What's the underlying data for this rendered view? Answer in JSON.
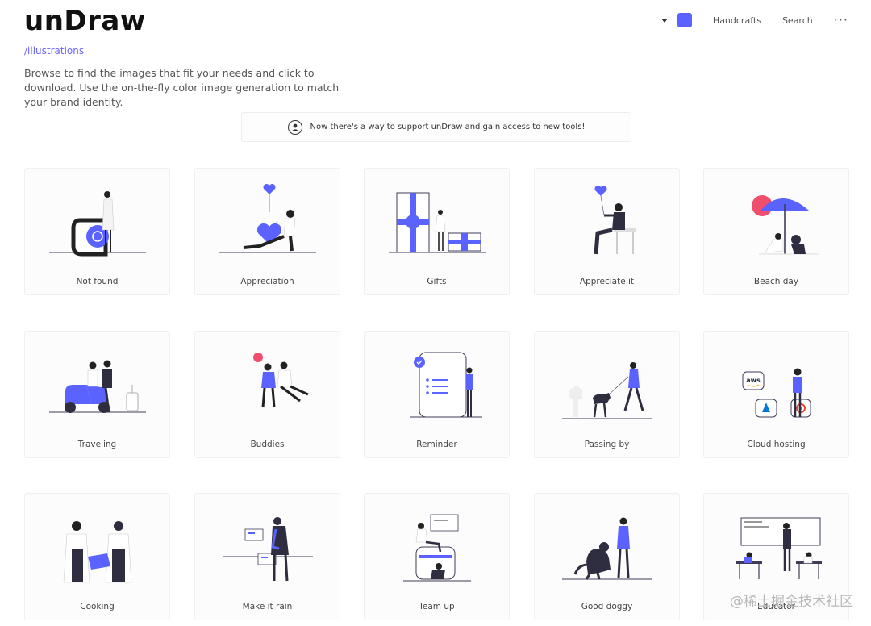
{
  "app": {
    "logo": "unDraw",
    "breadcrumb": "/illustrations"
  },
  "intro": "Browse to find the images that fit your needs and click to download. Use the on-the-fly color image generation to match your brand identity.",
  "nav": {
    "accent_color": "#5a63ff",
    "links": [
      "Handcrafts",
      "Search"
    ],
    "more_icon": "ellipsis-icon"
  },
  "banner": {
    "text": "Now there's a way to support unDraw and gain access to new tools!",
    "icon": "person-circle-icon"
  },
  "illustrations": [
    {
      "title": "Not found"
    },
    {
      "title": "Appreciation"
    },
    {
      "title": "Gifts"
    },
    {
      "title": "Appreciate it"
    },
    {
      "title": "Beach day"
    },
    {
      "title": "Traveling"
    },
    {
      "title": "Buddies"
    },
    {
      "title": "Reminder"
    },
    {
      "title": "Passing by"
    },
    {
      "title": "Cloud hosting"
    },
    {
      "title": "Cooking"
    },
    {
      "title": "Make it rain"
    },
    {
      "title": "Team up"
    },
    {
      "title": "Good doggy"
    },
    {
      "title": "Educator"
    }
  ],
  "cloud_badges": [
    "aws"
  ],
  "watermark": "@稀土掘金技术社区"
}
